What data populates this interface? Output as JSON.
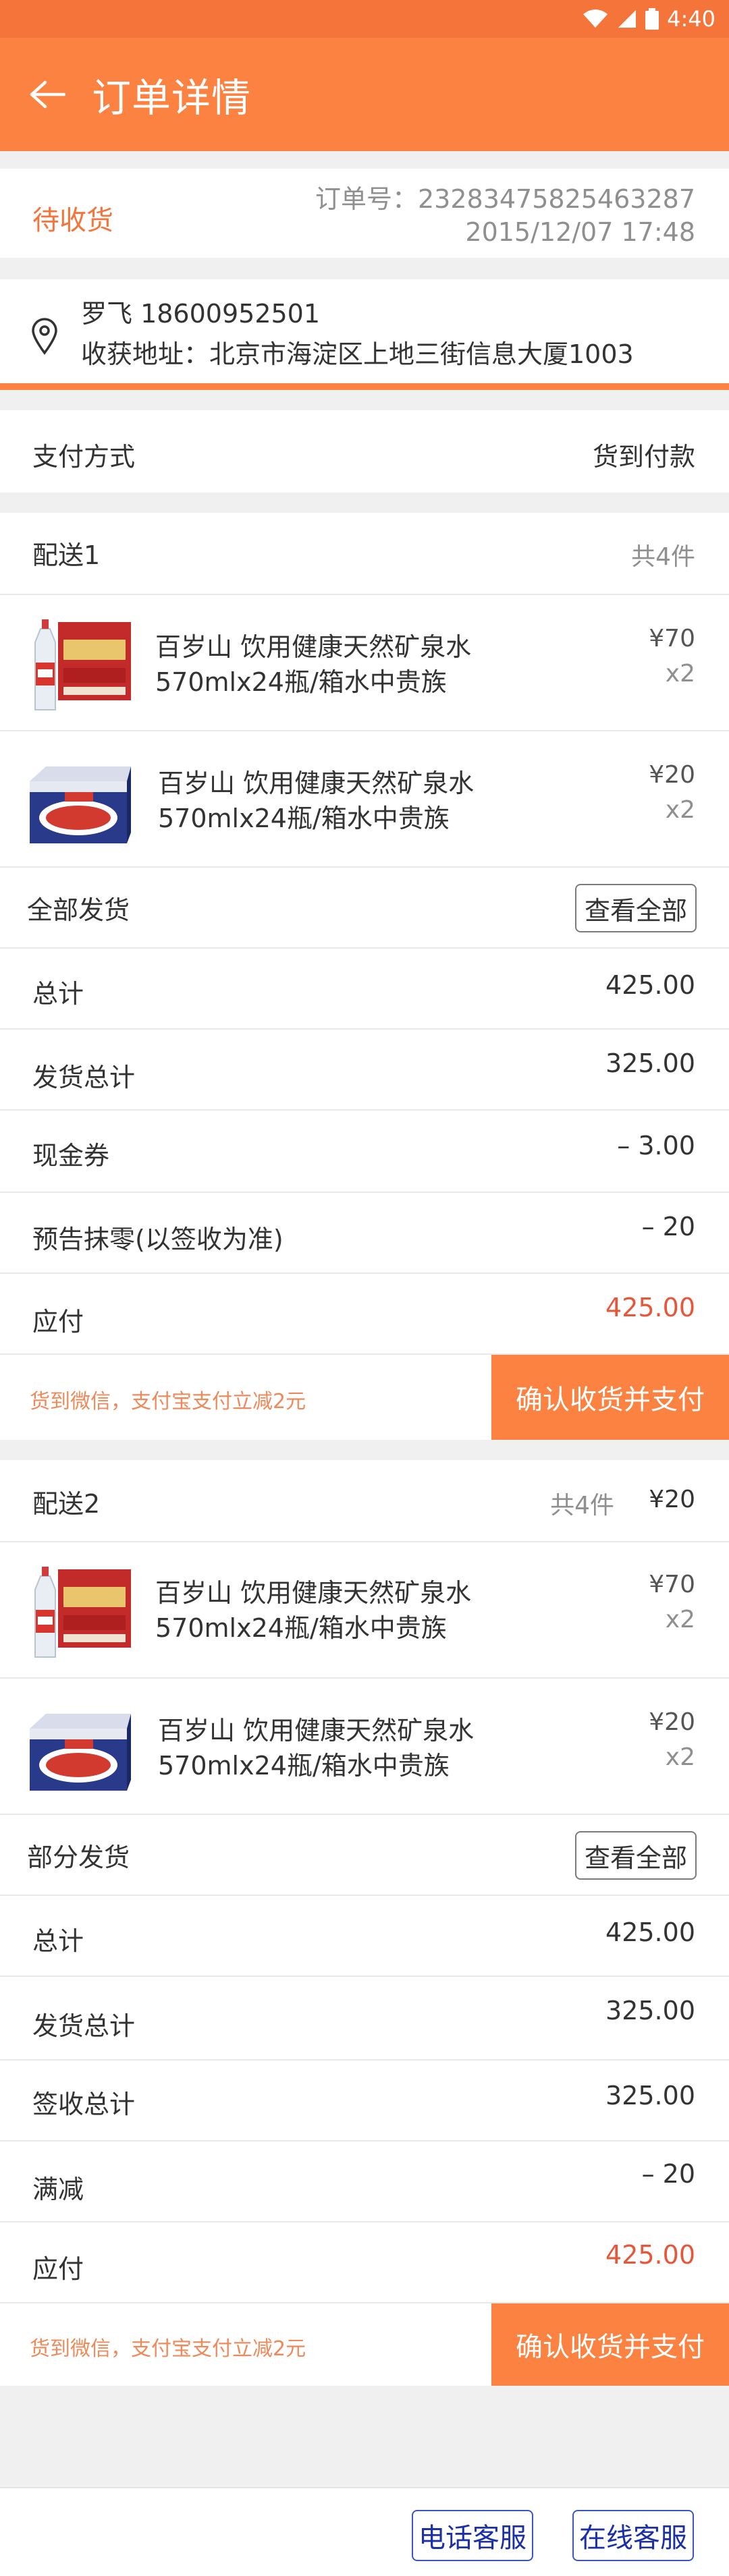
{
  "status_bar": {
    "time": "4:40"
  },
  "header": {
    "title": "订单详情"
  },
  "order": {
    "status": "待收货",
    "number_label": "订单号：23283475825463287",
    "datetime": "2015/12/07  17:48"
  },
  "address": {
    "name_phone": "罗飞    18600952501",
    "address": "收获地址：北京市海淀区上地三街信息大厦1003"
  },
  "payment": {
    "label": "支付方式",
    "value": "货到付款"
  },
  "deliveries": [
    {
      "title": "配送1",
      "count": "共4件",
      "price": "",
      "items": [
        {
          "name": "百岁山  饮用健康天然矿泉水",
          "spec": "570mlx24瓶/箱水中贵族",
          "price": "¥70",
          "qty": "x2",
          "image": "water-bottle-box-red"
        },
        {
          "name": "百岁山  饮用健康天然矿泉水",
          "spec": "570mlx24瓶/箱水中贵族",
          "price": "¥20",
          "qty": "x2",
          "image": "water-box-blue"
        }
      ],
      "ship_status": "全部发货",
      "view_all": "查看全部",
      "summary": [
        {
          "label": "总计",
          "value": "425.00"
        },
        {
          "label": "发货总计",
          "value": "325.00"
        },
        {
          "label": "现金券",
          "value": "– 3.00"
        },
        {
          "label": "预告抹零(以签收为准)",
          "value": "– 20"
        },
        {
          "label": "应付",
          "value": "425.00"
        }
      ],
      "promo": "货到微信，支付宝支付立减2元",
      "confirm": "确认收货并支付"
    },
    {
      "title": "配送2",
      "count": "共4件",
      "price": "¥20",
      "items": [
        {
          "name": "百岁山  饮用健康天然矿泉水",
          "spec": "570mlx24瓶/箱水中贵族",
          "price": "¥70",
          "qty": "x2",
          "image": "water-bottle-box-red"
        },
        {
          "name": "百岁山  饮用健康天然矿泉水",
          "spec": "570mlx24瓶/箱水中贵族",
          "price": "¥20",
          "qty": "x2",
          "image": "water-box-blue"
        }
      ],
      "ship_status": "部分发货",
      "view_all": "查看全部",
      "summary": [
        {
          "label": "总计",
          "value": "425.00"
        },
        {
          "label": "发货总计",
          "value": "325.00"
        },
        {
          "label": "签收总计",
          "value": "325.00"
        },
        {
          "label": "满减",
          "value": "– 20"
        },
        {
          "label": "应付",
          "value": "425.00"
        }
      ],
      "promo": "货到微信，支付宝支付立减2元",
      "confirm": "确认收货并支付"
    }
  ],
  "footer": {
    "phone_service": "电话客服",
    "online_service": "在线客服"
  },
  "colors": {
    "accent": "#fb8240",
    "status_bar": "#f5743a",
    "payable_red": "#e8563a",
    "footer_button_blue": "#1a2fa8"
  }
}
